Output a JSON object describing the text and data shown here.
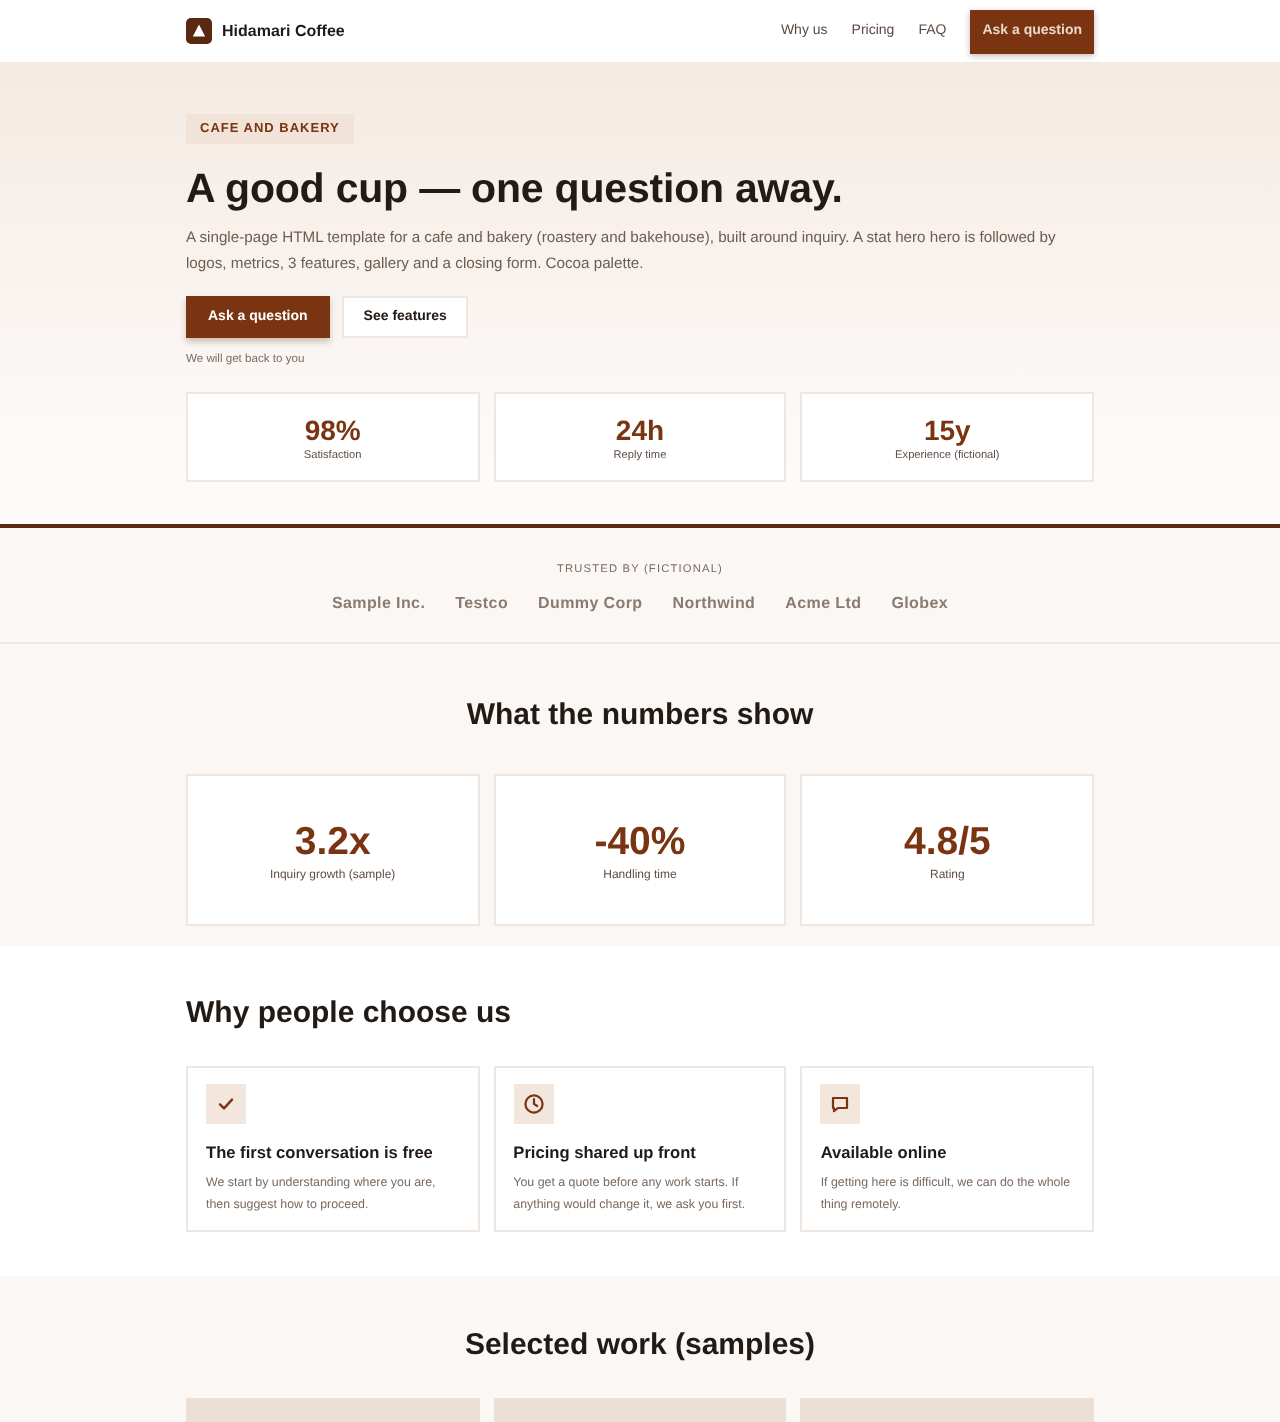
{
  "header": {
    "brand": "Hidamari Coffee",
    "nav": [
      "Why us",
      "Pricing",
      "FAQ"
    ],
    "cta": "Ask a question"
  },
  "hero": {
    "eyebrow": "CAFE AND BAKERY",
    "title": "A good cup — one question away.",
    "lead": "A single-page HTML template for a cafe and bakery (roastery and bakehouse), built around inquiry. A stat hero hero is followed by logos, metrics, 3 features, gallery and a closing form. Cocoa palette.",
    "buttons": [
      {
        "label": "Ask a question",
        "kind": "primary"
      },
      {
        "label": "See features",
        "kind": "secondary"
      }
    ],
    "note": "We will get back to you",
    "stats": [
      {
        "value": "98%",
        "label": "Satisfaction"
      },
      {
        "value": "24h",
        "label": "Reply time"
      },
      {
        "value": "15y",
        "label": "Experience (fictional)"
      }
    ]
  },
  "logos": {
    "heading": "TRUSTED BY (FICTIONAL)",
    "items": [
      "Sample Inc.",
      "Testco",
      "Dummy Corp",
      "Northwind",
      "Acme Ltd",
      "Globex"
    ]
  },
  "metrics": {
    "title": "What the numbers show",
    "items": [
      {
        "value": "3.2x",
        "label": "Inquiry growth (sample)"
      },
      {
        "value": "-40%",
        "label": "Handling time"
      },
      {
        "value": "4.8/5",
        "label": "Rating"
      }
    ]
  },
  "features": {
    "title": "Why people choose us",
    "items": [
      {
        "kind": "check",
        "title": "The first conversation is free",
        "text": "We start by understanding where you are, then suggest how to proceed."
      },
      {
        "kind": "clock",
        "title": "Pricing shared up front",
        "text": "You get a quote before any work starts. If anything would change it, we ask you first."
      },
      {
        "kind": "chat",
        "title": "Available online",
        "text": "If getting here is difficult, we can do the whole thing remotely."
      }
    ]
  },
  "gallery": {
    "title": "Selected work (samples)",
    "tiles": [
      {
        "kind": "photo"
      },
      {
        "kind": "photo"
      },
      {
        "kind": "photo"
      }
    ]
  }
}
